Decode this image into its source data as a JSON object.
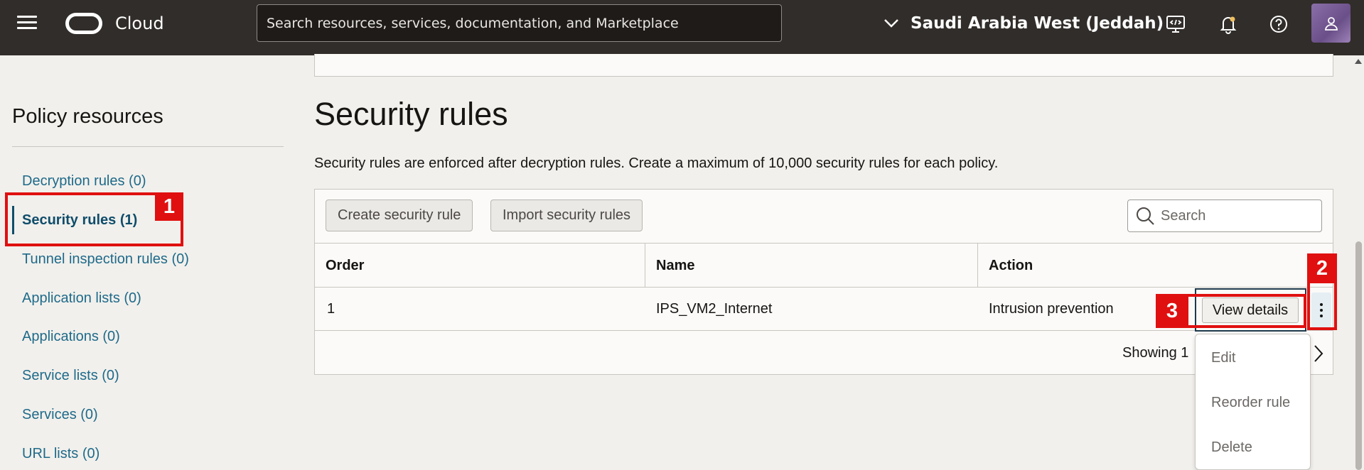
{
  "topbar": {
    "brand": "Cloud",
    "search_placeholder": "Search resources, services, documentation, and Marketplace",
    "region": "Saudi Arabia West (Jeddah)"
  },
  "sidebar": {
    "title": "Policy resources",
    "items": [
      {
        "label": "Decryption rules (0)"
      },
      {
        "label": "Security rules (1)",
        "active": true
      },
      {
        "label": "Tunnel inspection rules (0)"
      },
      {
        "label": "Application lists (0)"
      },
      {
        "label": "Applications (0)"
      },
      {
        "label": "Service lists (0)"
      },
      {
        "label": "Services (0)"
      },
      {
        "label": "URL lists (0)"
      }
    ]
  },
  "main": {
    "title": "Security rules",
    "description": "Security rules are enforced after decryption rules. Create a maximum of 10,000 security rules for each policy.",
    "buttons": {
      "create": "Create security rule",
      "import": "Import security rules"
    },
    "search_placeholder": "Search",
    "table": {
      "headers": [
        "Order",
        "Name",
        "Action"
      ],
      "rows": [
        [
          "1",
          "IPS_VM2_Internet",
          "Intrusion prevention"
        ]
      ],
      "footer": "Showing 1"
    },
    "view_details": "View details",
    "menu": [
      "Edit",
      "Reorder rule",
      "Delete"
    ]
  },
  "callouts": [
    "1",
    "2",
    "3"
  ],
  "colors": {
    "topbar": "#312d2a",
    "link": "#1e6a8a",
    "callout": "#e01010"
  }
}
